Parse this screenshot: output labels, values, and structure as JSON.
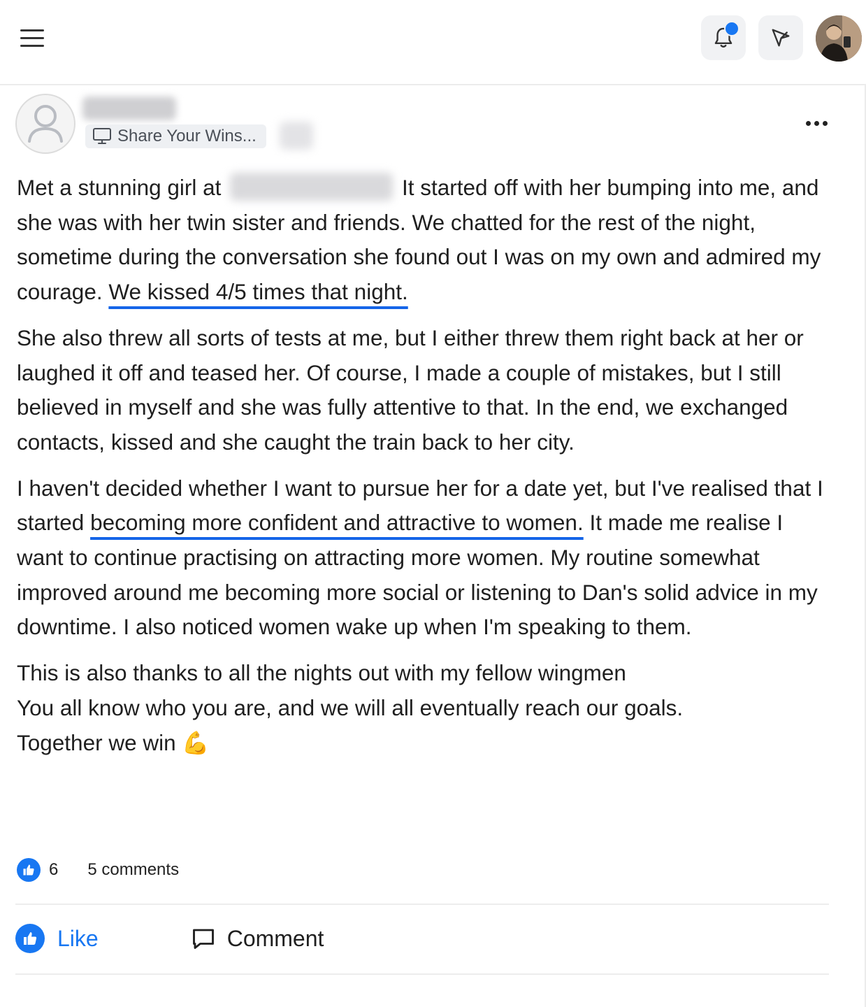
{
  "header": {
    "menu_icon": "hamburger-menu-icon",
    "notification_icon": "bell-icon",
    "notification_badge_color": "#1877f2",
    "send_icon": "paper-plane-icon",
    "profile_avatar": "user-photo"
  },
  "post": {
    "author_avatar_icon": "default-user-icon",
    "category_icon": "monitor-icon",
    "category": "Share Your Wins...",
    "more_icon": "ellipsis-icon",
    "paragraphs": {
      "p1a": "Met a stunning girl at",
      "p1b": "It started off with her bumping into me, and she was with her twin sister and friends. We chatted for the rest of the night, sometime during the conversation she found out I was on my own and admired my courage.",
      "p1c": "We kissed 4/5 times that night.",
      "p2": "She also threw all sorts of tests at me, but I either threw them right back at her or laughed it off and teased her. Of course, I made a couple of mistakes, but I still believed in myself and she was fully attentive to that. In the end, we exchanged contacts, kissed and she caught the train back to her city.",
      "p3a": "I haven't decided whether I want to pursue her for a date yet, but I've realised that I started",
      "p3b": "becoming more confident and attractive to women.",
      "p3c": "It made me realise I want to continue practising on attracting more women. My routine somewhat improved around me becoming more social or listening to Dan's solid advice in my downtime. I also noticed women wake up when I'm speaking to them.",
      "p4a": "This is also thanks to all the nights out with my fellow wingmen",
      "p4b": "You all know who you are, and we will all eventually reach our goals.",
      "p4c": "Together we win",
      "p4_emoji": "💪"
    },
    "highlight_color": "#1565e8"
  },
  "stats": {
    "like_icon": "thumbs-up-icon",
    "likes": "6",
    "comments": "5 comments"
  },
  "actions": {
    "like_label": "Like",
    "comment_label": "Comment",
    "comment_icon": "speech-bubble-icon",
    "accent_color": "#1877f2"
  }
}
